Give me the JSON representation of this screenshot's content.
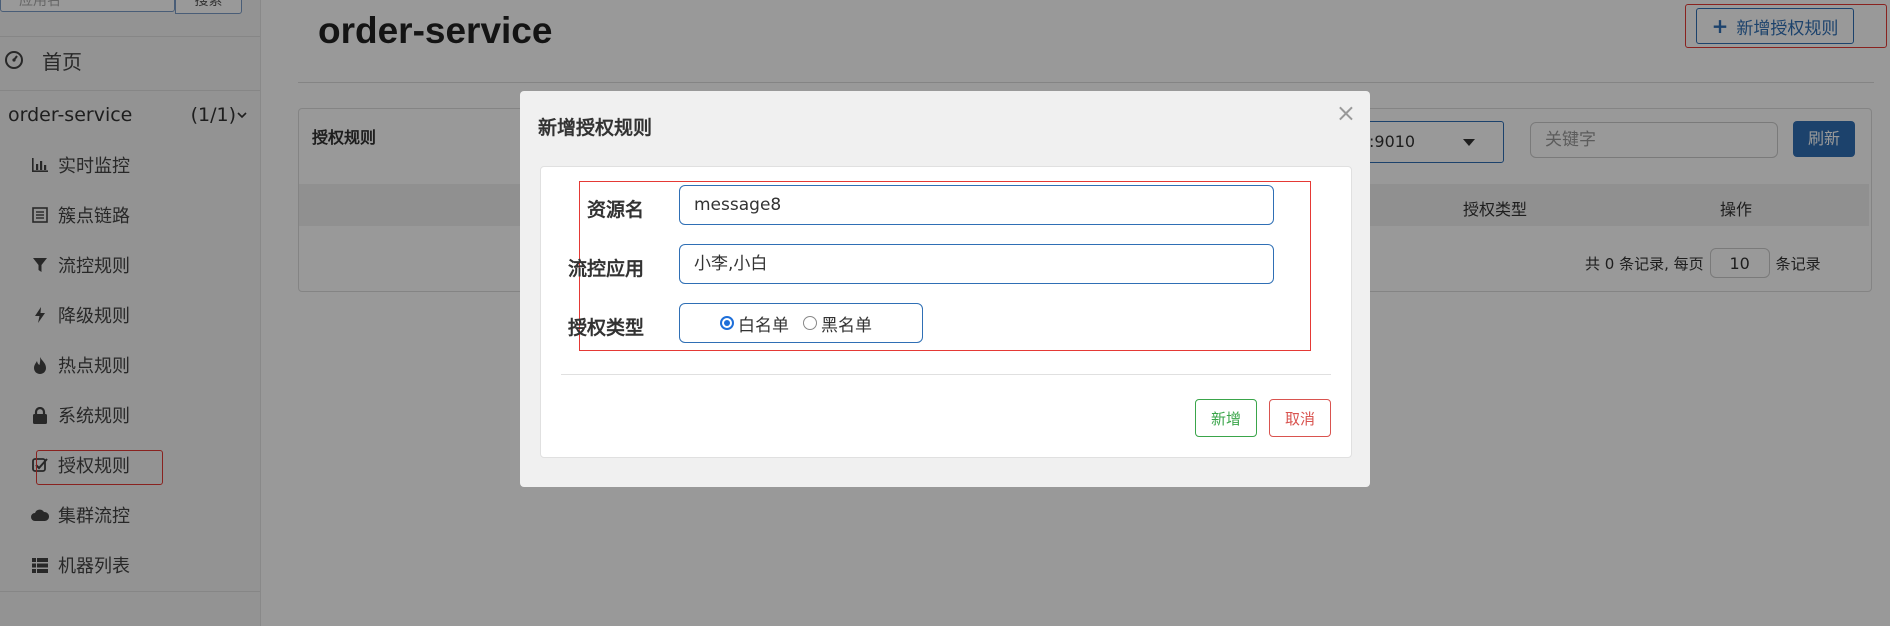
{
  "sidebar": {
    "search": {
      "placeholder": "应用名",
      "button": "搜索"
    },
    "home_label": "首页",
    "app": {
      "name": "order-service",
      "count": "(1/1)"
    },
    "items": [
      {
        "label": "实时监控",
        "icon": "bar-chart-icon"
      },
      {
        "label": "簇点链路",
        "icon": "list-icon"
      },
      {
        "label": "流控规则",
        "icon": "filter-icon"
      },
      {
        "label": "降级规则",
        "icon": "flash-icon"
      },
      {
        "label": "热点规则",
        "icon": "fire-icon"
      },
      {
        "label": "系统规则",
        "icon": "lock-icon"
      },
      {
        "label": "授权规则",
        "icon": "check-square-icon"
      },
      {
        "label": "集群流控",
        "icon": "cloud-icon"
      },
      {
        "label": "机器列表",
        "icon": "th-list-icon"
      }
    ]
  },
  "header": {
    "title": "order-service",
    "add_button": "新增授权规则"
  },
  "panel": {
    "title": "授权规则",
    "machine": ":9010",
    "keyword_placeholder": "关键字",
    "refresh": "刷新",
    "columns": {
      "type": "授权类型",
      "op": "操作"
    },
    "pager": {
      "prefix": "共 0 条记录, 每页",
      "page_size": "10",
      "suffix": "条记录"
    }
  },
  "modal": {
    "title": "新增授权规则",
    "close": "×",
    "form": {
      "resource_label": "资源名",
      "resource_value": "message8",
      "limit_app_label": "流控应用",
      "limit_app_value": "小李,小白",
      "strategy_label": "授权类型",
      "options": [
        "白名单",
        "黑名单"
      ],
      "selected": "白名单"
    },
    "ok": "新增",
    "cancel": "取消"
  },
  "colors": {
    "primary": "#2f6fb5",
    "success": "#3aa54a",
    "danger": "#d9534f",
    "highlight": "#e53935"
  }
}
